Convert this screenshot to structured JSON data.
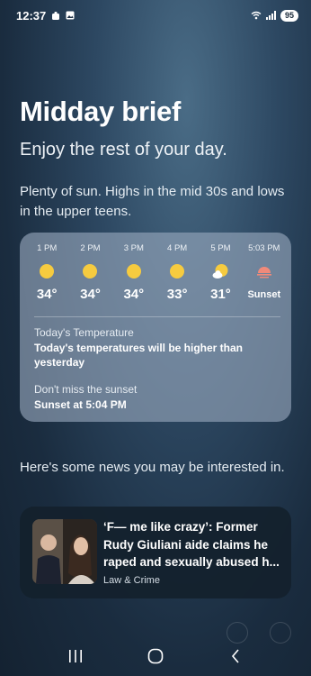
{
  "status": {
    "time": "12:37",
    "battery": "95",
    "icons": [
      "notification-icon",
      "gallery-icon",
      "wifi-icon",
      "signal-icon"
    ]
  },
  "brief": {
    "title": "Midday brief",
    "subtitle": "Enjoy the rest of your day.",
    "summary": "Plenty of sun. Highs in the mid 30s and lows in the upper teens."
  },
  "weather": {
    "hours": [
      {
        "time": "1 PM",
        "temp": "34°",
        "icon": "sun-icon"
      },
      {
        "time": "2 PM",
        "temp": "34°",
        "icon": "sun-icon"
      },
      {
        "time": "3 PM",
        "temp": "34°",
        "icon": "sun-icon"
      },
      {
        "time": "4 PM",
        "temp": "33°",
        "icon": "sun-icon"
      },
      {
        "time": "5 PM",
        "temp": "31°",
        "icon": "partly-cloudy-icon"
      },
      {
        "time": "5:03 PM",
        "temp": "Sunset",
        "icon": "sunset-icon"
      }
    ],
    "temp_label": "Today's Temperature",
    "temp_value": "Today's temperatures will be higher than yesterday",
    "sunset_label": "Don't miss the sunset",
    "sunset_value": "Sunset at 5:04 PM"
  },
  "news": {
    "intro": "Here's some news you may be interested in.",
    "title": "‘F— me like crazy’: Former Rudy Giuliani aide claims he raped and sexually abused h...",
    "source": "Law & Crime"
  },
  "colors": {
    "sun": "#f6cb3f",
    "sunset": "#f08a7a"
  }
}
